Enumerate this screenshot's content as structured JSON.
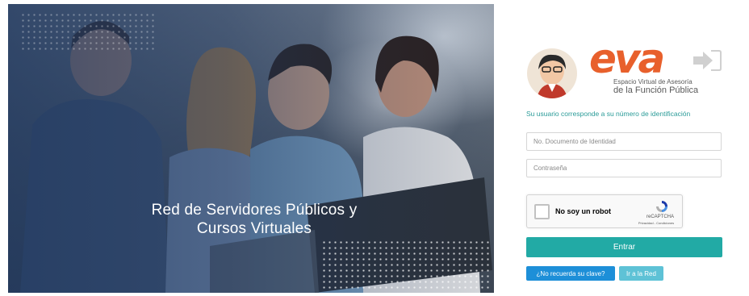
{
  "hero": {
    "title_line1": "Red de Servidores Públicos y",
    "title_line2": "Cursos Virtuales"
  },
  "logo": {
    "wordmark": "eva",
    "subtitle_line1": "Espacio Virtual de Asesoría",
    "subtitle_line2": "de la Función Pública"
  },
  "login": {
    "hint": "Su usuario corresponde a su número de identificación",
    "id_placeholder": "No. Documento de Identidad",
    "id_value": "",
    "password_placeholder": "Contraseña",
    "password_value": "",
    "enter_label": "Entrar",
    "forgot_label": "¿No recuerda su clave?",
    "go_network_label": "Ir a la Red"
  },
  "captcha": {
    "label": "No soy un robot",
    "brand": "reCAPTCHA",
    "terms": "Privacidad - Condiciones"
  },
  "colors": {
    "accent_teal": "#22aaa5",
    "logo_orange": "#e8602c",
    "forgot_blue": "#1d8fd8",
    "network_blue": "#5ec2d6"
  }
}
